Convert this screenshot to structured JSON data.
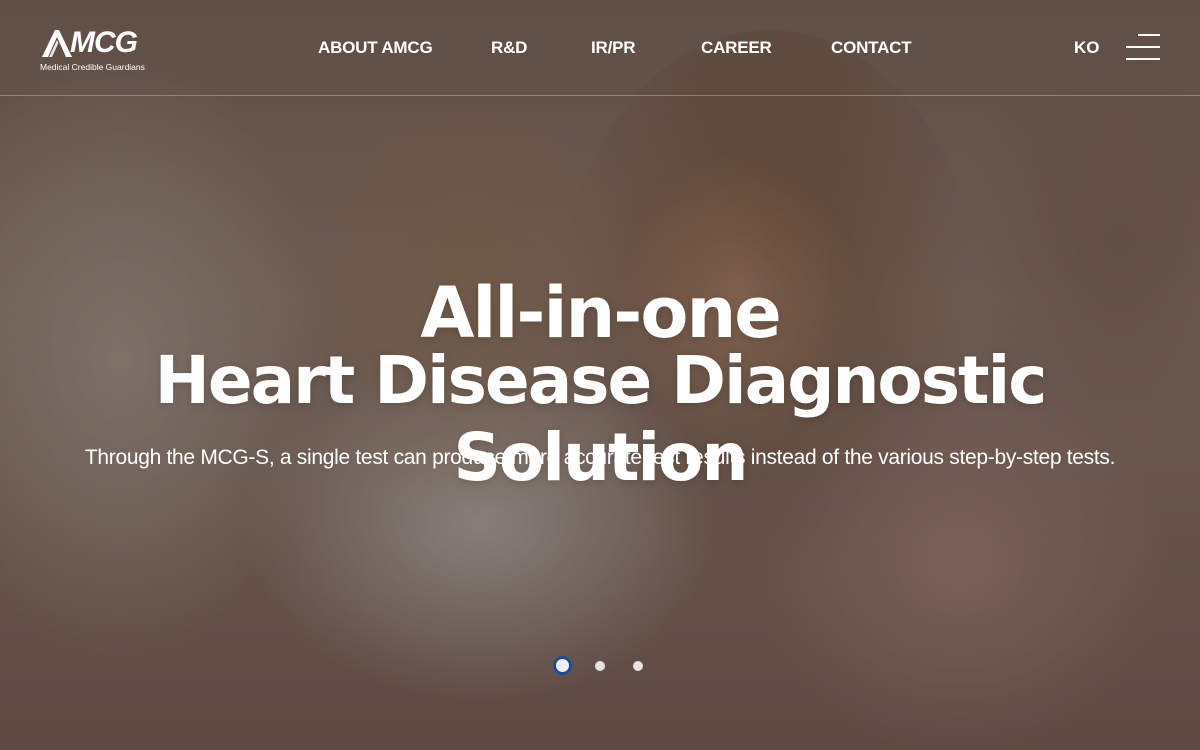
{
  "brand": {
    "logo_text": "MCG",
    "tagline": "Medical Credible Guardians",
    "logo_icon": "a-shape-logo-mark"
  },
  "nav": {
    "items": [
      {
        "label": "ABOUT AMCG"
      },
      {
        "label": "R&D"
      },
      {
        "label": "IR/PR"
      },
      {
        "label": "CAREER"
      },
      {
        "label": "CONTACT"
      }
    ],
    "language": "KO",
    "menu_icon": "hamburger-menu-icon"
  },
  "hero": {
    "title_line1": "All-in-one",
    "title_line2": "Heart Disease Diagnostic Solution",
    "subtitle": "Through the MCG-S, a single test can produce more accurate test results instead of the various step-by-step tests.",
    "slides_total": 3,
    "active_slide": 1
  },
  "colors": {
    "accent": "#1e4a9e",
    "text": "#ffffff"
  }
}
